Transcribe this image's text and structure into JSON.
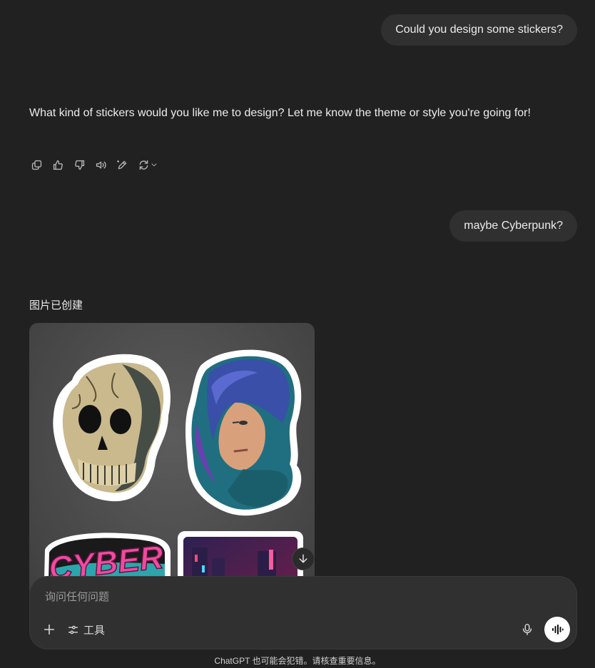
{
  "conversation": {
    "user_message_1": "Could you design some stickers?",
    "assistant_message_1": "What kind of stickers would you like me to design? Let me know the theme or style you're going for!",
    "user_message_2": "maybe Cyberpunk?",
    "image_created_label": "图片已创建"
  },
  "message_actions": {
    "icons": [
      "copy-icon",
      "thumbs-up-icon",
      "thumbs-down-icon",
      "read-aloud-icon",
      "edit-icon",
      "regenerate-icon",
      "chevron-down-icon"
    ]
  },
  "generated_image": {
    "sticker_text": "CYBER",
    "download_icon": "arrow-down-icon"
  },
  "composer": {
    "placeholder": "询问任何问题",
    "tools_label": "工具"
  },
  "footer": {
    "disclaimer": "ChatGPT 也可能会犯错。请核查重要信息。"
  },
  "colors": {
    "background": "#212121",
    "bubble": "#303030",
    "text": "#ececec",
    "muted": "#9b9b9b",
    "accent_pink": "#f04aa0",
    "accent_teal": "#2fc0c8"
  }
}
